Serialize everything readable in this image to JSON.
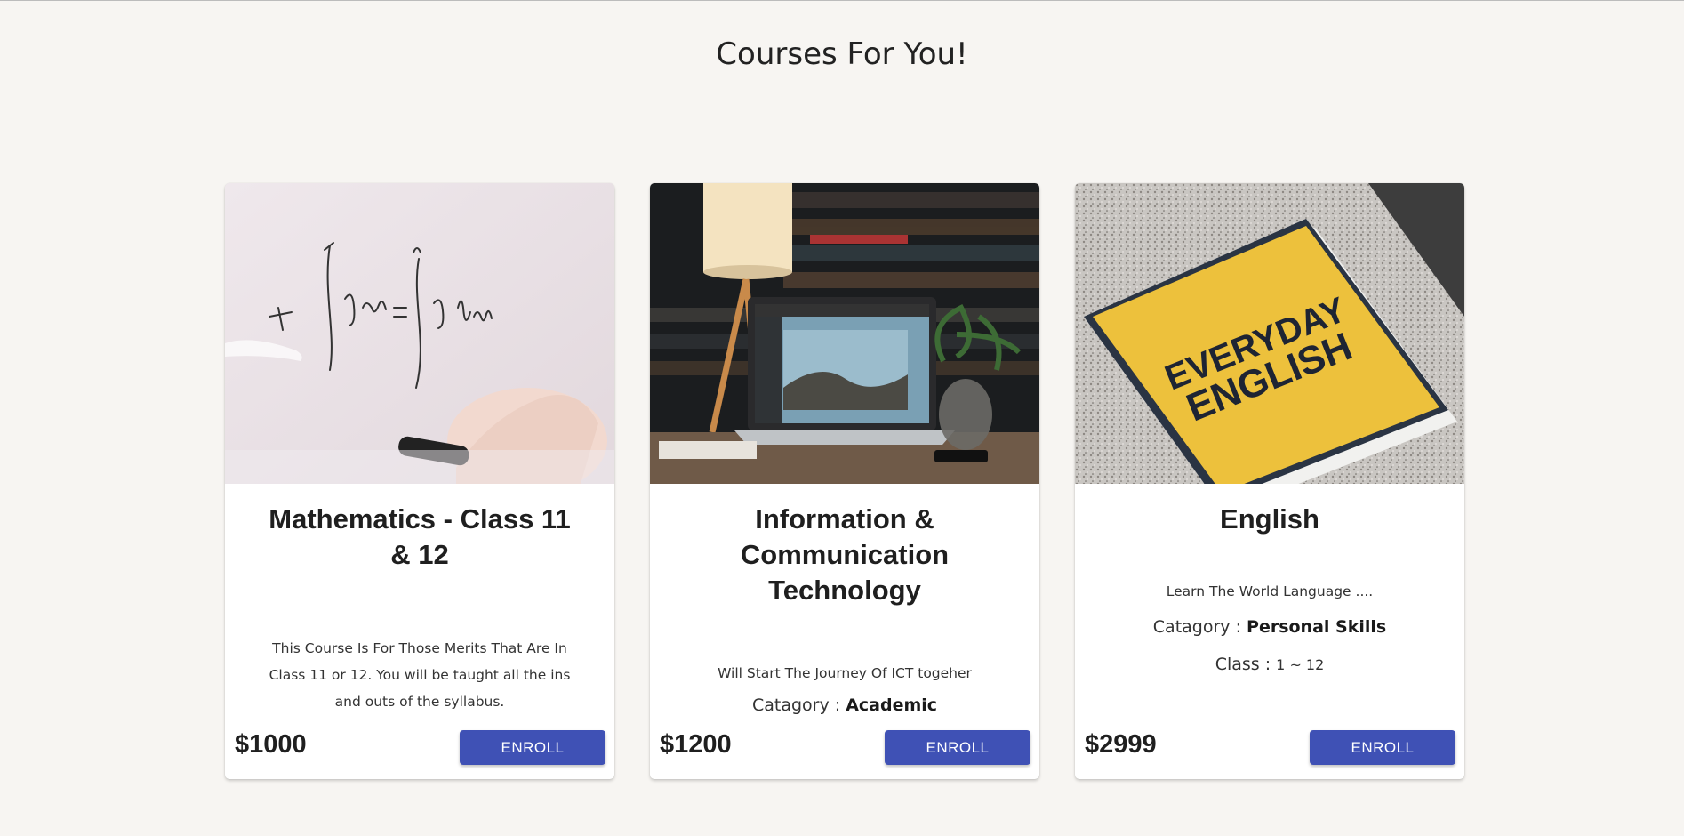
{
  "page": {
    "title": "Courses For You!"
  },
  "courses": [
    {
      "title": "Mathematics - Class 11 & 12",
      "description": "This Course Is For Those Merits That Are In Class 11 or 12. You will be taught all the ins and outs of the syllabus.",
      "price": "$1000",
      "enroll_label": "ENROLL",
      "image": "whiteboard-math-image"
    },
    {
      "title": "Information & Communication Technology",
      "description": "Will Start The Journey Of ICT togeher",
      "category_label": "Catagory :",
      "category_value": "Academic",
      "price": "$1200",
      "enroll_label": "ENROLL",
      "image": "laptop-desk-image"
    },
    {
      "title": "English",
      "description": "Learn The World Language ....",
      "category_label": "Catagory :",
      "category_value": "Personal Skills",
      "class_label": "Class :",
      "class_value": "1 ~ 12",
      "price": "$2999",
      "enroll_label": "ENROLL",
      "image": "everyday-english-book-image",
      "image_text": [
        "EVERYDAY",
        "ENGLISH"
      ]
    }
  ],
  "colors": {
    "background": "#f7f5f2",
    "button": "#3f51b5",
    "button_text": "#ffffff"
  }
}
